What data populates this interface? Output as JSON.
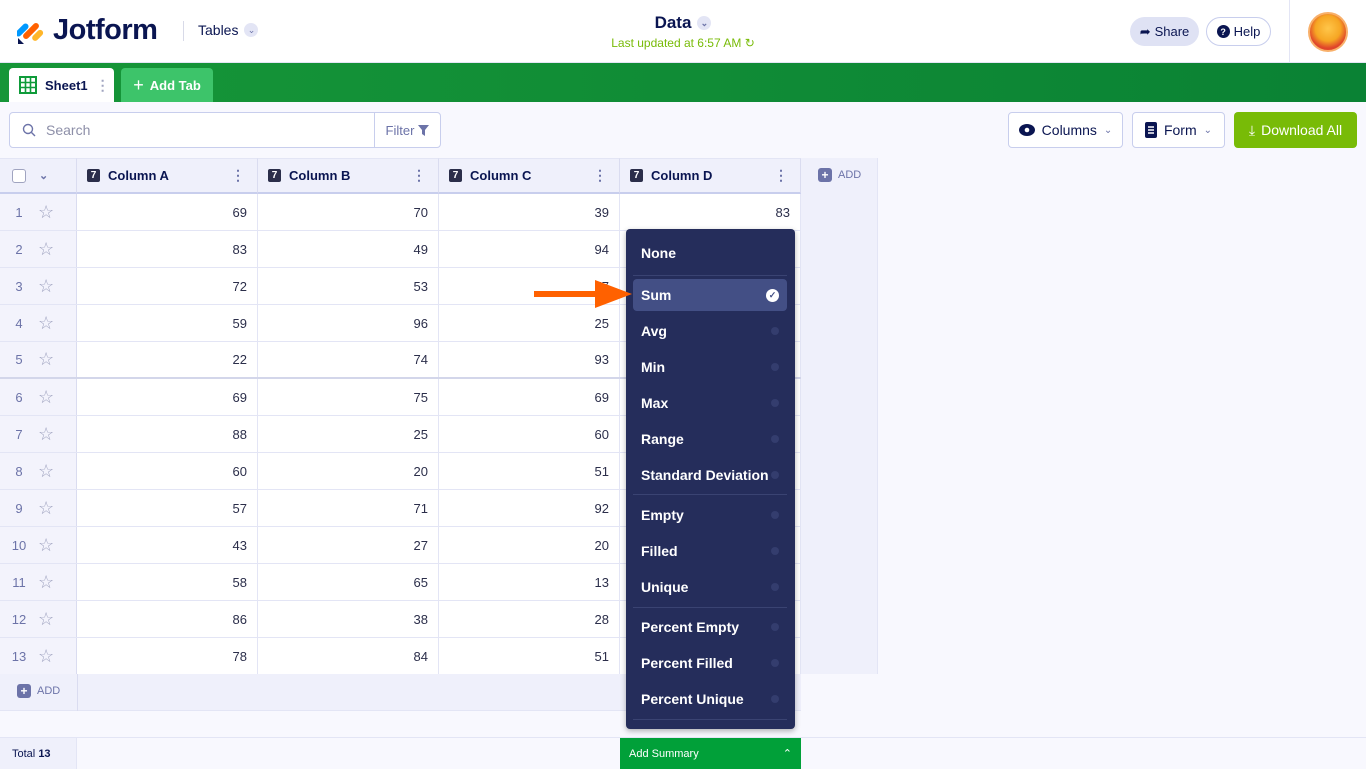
{
  "header": {
    "brand": "Jotform",
    "app": "Tables",
    "title": "Data",
    "updated": "Last updated at 6:57 AM",
    "share": "Share",
    "help": "Help"
  },
  "tabs": {
    "sheet": "Sheet1",
    "add": "Add Tab"
  },
  "toolbar": {
    "search_placeholder": "Search",
    "filter": "Filter",
    "columns": "Columns",
    "form": "Form",
    "download": "Download All"
  },
  "table": {
    "columns": [
      "Column A",
      "Column B",
      "Column C",
      "Column D"
    ],
    "add": "ADD",
    "rows": [
      [
        "1",
        "69",
        "70",
        "39",
        "83"
      ],
      [
        "2",
        "83",
        "49",
        "94",
        ""
      ],
      [
        "3",
        "72",
        "53",
        "77",
        ""
      ],
      [
        "4",
        "59",
        "96",
        "25",
        ""
      ],
      [
        "5",
        "22",
        "74",
        "93",
        ""
      ],
      [
        "6",
        "69",
        "75",
        "69",
        ""
      ],
      [
        "7",
        "88",
        "25",
        "60",
        ""
      ],
      [
        "8",
        "60",
        "20",
        "51",
        ""
      ],
      [
        "9",
        "57",
        "71",
        "92",
        ""
      ],
      [
        "10",
        "43",
        "27",
        "20",
        ""
      ],
      [
        "11",
        "58",
        "65",
        "13",
        ""
      ],
      [
        "12",
        "86",
        "38",
        "28",
        ""
      ],
      [
        "13",
        "78",
        "84",
        "51",
        ""
      ]
    ]
  },
  "footer": {
    "total_label": "Total",
    "total": "13",
    "add_summary": "Add Summary"
  },
  "menu": {
    "items": [
      "None",
      "Sum",
      "Avg",
      "Min",
      "Max",
      "Range",
      "Standard Deviation",
      "Empty",
      "Filled",
      "Unique",
      "Percent Empty",
      "Percent Filled",
      "Percent Unique"
    ],
    "selected": "Sum"
  },
  "colors": {
    "green": "#0a8234",
    "accent": "#78bb07",
    "menu": "#252d5b",
    "arrow": "#ff6100"
  }
}
